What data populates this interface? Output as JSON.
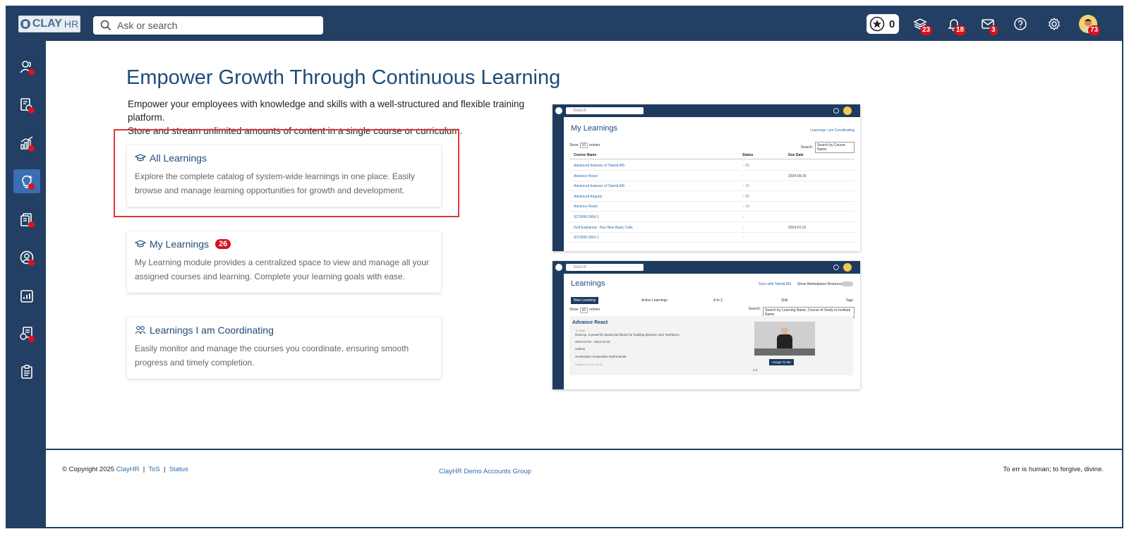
{
  "brand": {
    "logo_text": "CLAY",
    "logo_suffix": "HR"
  },
  "search": {
    "placeholder": "Ask or search"
  },
  "header_icons": {
    "points": "0",
    "courses_badge": "23",
    "notifications_badge": "18",
    "messages_badge": "3",
    "avatar_badge": "73"
  },
  "main": {
    "title": "Empower Growth Through Continuous Learning",
    "subtitle_line1": "Empower your employees with knowledge and skills with a well-structured and flexible training platform.",
    "subtitle_line2": "Store and stream unlimited amounts of content in a single course or curriculum.",
    "cards": [
      {
        "title": "All Learnings",
        "desc": "Explore the complete catalog of system-wide learnings in one place. Easily browse and manage learning opportunities for growth and development."
      },
      {
        "title": "My Learnings",
        "badge": "26",
        "desc": "My Learning module provides a centralized space to view and manage all your assigned courses and learning. Complete your learning goals with ease."
      },
      {
        "title": "Learnings I am Coordinating",
        "desc": "Easily monitor and manage the courses you coordinate, ensuring smooth progress and timely completion."
      }
    ]
  },
  "preview1": {
    "search": "Search",
    "title": "My Learnings",
    "link": "Learnings I am Coordinating",
    "show": "Show",
    "entries_value": "10",
    "entries": "entries",
    "search_label": "Search:",
    "search_placeholder": "Search by Course Name",
    "columns": [
      "Course Name",
      "Status",
      "Due Date"
    ],
    "rows": [
      {
        "name": "Advanced features of TalentLMS",
        "status": "89",
        "due": ""
      },
      {
        "name": "Advance React",
        "status": "",
        "due": "2024-09-30"
      },
      {
        "name": "Advanced features of TalentLMS",
        "status": "15",
        "due": ""
      },
      {
        "name": "Advanced Angular",
        "status": "90",
        "due": ""
      },
      {
        "name": "Advance React",
        "status": "10",
        "due": ""
      },
      {
        "name": "SCORM 2004-1",
        "status": "",
        "due": ""
      },
      {
        "name": "Golf Explained - Run New Basic Calls",
        "status": "",
        "due": "2024-01-31"
      },
      {
        "name": "SCORM 2004-1",
        "status": "",
        "due": ""
      }
    ]
  },
  "preview2": {
    "search": "Search",
    "title": "Learnings",
    "sync": "Sync with TalentLMS",
    "marketplace": "Show Marketplace Resources",
    "new_button": "New Learning",
    "filter1": "Active Learnings",
    "filter2": "A to Z",
    "filter3": "Skill",
    "tags": "Tags",
    "show": "Show",
    "entries_value": "10",
    "entries": "entries",
    "search_label": "Search:",
    "search_placeholder": "Search by Learning Name, Course of Study or Institute Name",
    "course_title": "Advance React",
    "course_meta": "15 skills",
    "course_desc": "React.js, a powerful JavaScript library for building dynamic user interfaces.",
    "course_dates": "2024-10-04 - 2024-10-31",
    "course_type": "Udemy",
    "course_location": "Amsterdam Amsterdam Netherlands",
    "course_added": "Added on 2024-09-13",
    "assign_button": "Assign To Me",
    "rating": "1.0"
  },
  "footer": {
    "copyright": "© Copyright 2025",
    "brand_link": "ClayHR",
    "tos": "ToS",
    "status": "Status",
    "sep": "|",
    "group": "ClayHR Demo Accounts Group",
    "quote": "To err is human; to forgive, divine."
  },
  "colors": {
    "nav": "#233f63",
    "accent": "#3a6fb1",
    "badge": "#d9101b",
    "highlight": "#e1353a",
    "title": "#1f4b7a"
  }
}
